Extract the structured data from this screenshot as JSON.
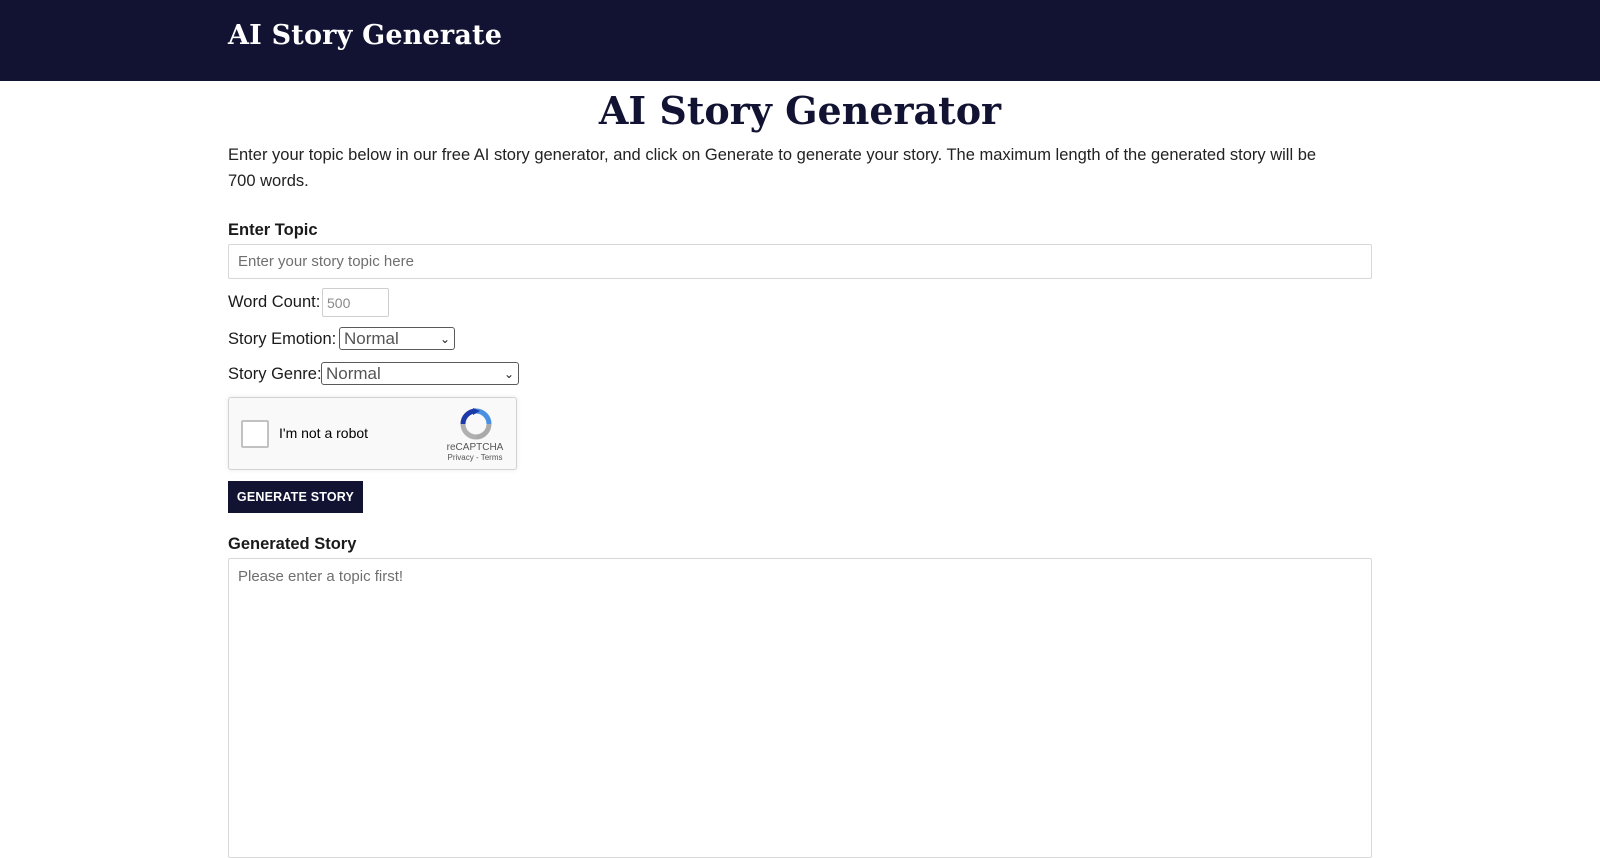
{
  "header": {
    "site_title": "AI Story Generate"
  },
  "main": {
    "title": "AI Story Generator",
    "intro": "Enter your topic below in our free AI story generator, and click on Generate to generate your story. The maximum length of the generated story will be 700 words."
  },
  "form": {
    "topic_label": "Enter Topic",
    "topic_placeholder": "Enter your story topic here",
    "word_count_label": "Word Count:",
    "word_count_placeholder": "500",
    "emotion_label": "Story Emotion:",
    "emotion_value": "Normal",
    "genre_label": "Story Genre:",
    "genre_value": "Normal",
    "captcha": {
      "label": "I'm not a robot",
      "brand": "reCAPTCHA",
      "links": "Privacy - Terms",
      "logo_icon": "recaptcha-icon"
    },
    "generate_label": "GENERATE STORY",
    "output_label": "Generated Story",
    "output_placeholder": "Please enter a topic first!"
  },
  "colors": {
    "header_bg": "#121333",
    "button_bg": "#121333",
    "title_color": "#121333"
  }
}
